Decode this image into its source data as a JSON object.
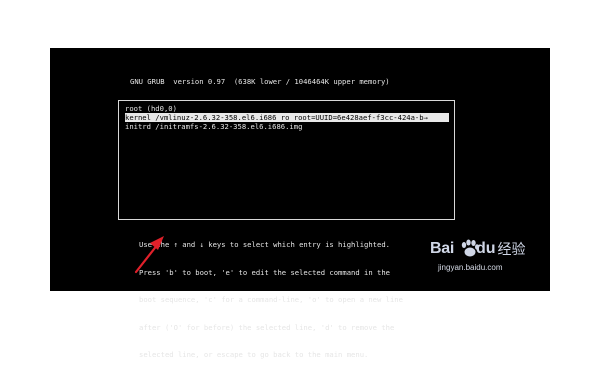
{
  "grub": {
    "header": "GNU GRUB  version 0.97  (638K lower / 1046464K upper memory)",
    "entries": [
      "root (hd0,0)",
      "kernel /vmlinuz-2.6.32-358.el6.i686 ro root=UUID=6e428aef-f3cc-424a-b→",
      "initrd /initramfs-2.6.32-358.el6.i686.img"
    ],
    "selected_index": 1,
    "help": [
      "Use the ↑ and ↓ keys to select which entry is highlighted.",
      "Press 'b' to boot, 'e' to edit the selected command in the",
      "boot sequence, 'c' for a command-line, 'o' to open a new line",
      "after ('O' for before) the selected line, 'd' to remove the",
      "selected line, or escape to go back to the main menu."
    ]
  },
  "watermark": {
    "brand_left": "Bai",
    "brand_right": "du",
    "brand_cn": "经验",
    "url": "jingyan.baidu.com"
  },
  "colors": {
    "console_bg": "#000000",
    "console_text": "#e6e6e6",
    "annotation_arrow": "#e0202a"
  }
}
